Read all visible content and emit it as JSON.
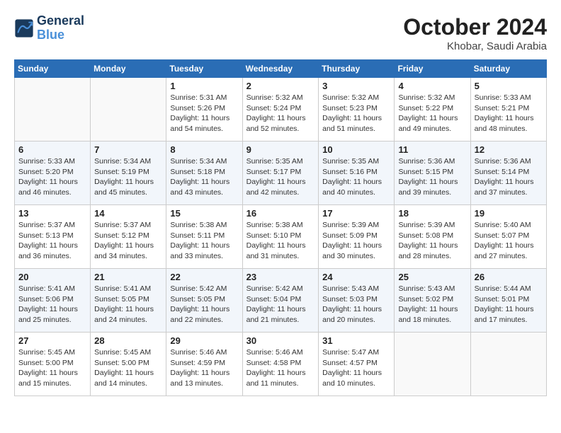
{
  "logo": {
    "line1": "General",
    "line2": "Blue"
  },
  "title": "October 2024",
  "location": "Khobar, Saudi Arabia",
  "weekdays": [
    "Sunday",
    "Monday",
    "Tuesday",
    "Wednesday",
    "Thursday",
    "Friday",
    "Saturday"
  ],
  "weeks": [
    [
      {
        "day": "",
        "info": ""
      },
      {
        "day": "",
        "info": ""
      },
      {
        "day": "1",
        "info": "Sunrise: 5:31 AM\nSunset: 5:26 PM\nDaylight: 11 hours and 54 minutes."
      },
      {
        "day": "2",
        "info": "Sunrise: 5:32 AM\nSunset: 5:24 PM\nDaylight: 11 hours and 52 minutes."
      },
      {
        "day": "3",
        "info": "Sunrise: 5:32 AM\nSunset: 5:23 PM\nDaylight: 11 hours and 51 minutes."
      },
      {
        "day": "4",
        "info": "Sunrise: 5:32 AM\nSunset: 5:22 PM\nDaylight: 11 hours and 49 minutes."
      },
      {
        "day": "5",
        "info": "Sunrise: 5:33 AM\nSunset: 5:21 PM\nDaylight: 11 hours and 48 minutes."
      }
    ],
    [
      {
        "day": "6",
        "info": "Sunrise: 5:33 AM\nSunset: 5:20 PM\nDaylight: 11 hours and 46 minutes."
      },
      {
        "day": "7",
        "info": "Sunrise: 5:34 AM\nSunset: 5:19 PM\nDaylight: 11 hours and 45 minutes."
      },
      {
        "day": "8",
        "info": "Sunrise: 5:34 AM\nSunset: 5:18 PM\nDaylight: 11 hours and 43 minutes."
      },
      {
        "day": "9",
        "info": "Sunrise: 5:35 AM\nSunset: 5:17 PM\nDaylight: 11 hours and 42 minutes."
      },
      {
        "day": "10",
        "info": "Sunrise: 5:35 AM\nSunset: 5:16 PM\nDaylight: 11 hours and 40 minutes."
      },
      {
        "day": "11",
        "info": "Sunrise: 5:36 AM\nSunset: 5:15 PM\nDaylight: 11 hours and 39 minutes."
      },
      {
        "day": "12",
        "info": "Sunrise: 5:36 AM\nSunset: 5:14 PM\nDaylight: 11 hours and 37 minutes."
      }
    ],
    [
      {
        "day": "13",
        "info": "Sunrise: 5:37 AM\nSunset: 5:13 PM\nDaylight: 11 hours and 36 minutes."
      },
      {
        "day": "14",
        "info": "Sunrise: 5:37 AM\nSunset: 5:12 PM\nDaylight: 11 hours and 34 minutes."
      },
      {
        "day": "15",
        "info": "Sunrise: 5:38 AM\nSunset: 5:11 PM\nDaylight: 11 hours and 33 minutes."
      },
      {
        "day": "16",
        "info": "Sunrise: 5:38 AM\nSunset: 5:10 PM\nDaylight: 11 hours and 31 minutes."
      },
      {
        "day": "17",
        "info": "Sunrise: 5:39 AM\nSunset: 5:09 PM\nDaylight: 11 hours and 30 minutes."
      },
      {
        "day": "18",
        "info": "Sunrise: 5:39 AM\nSunset: 5:08 PM\nDaylight: 11 hours and 28 minutes."
      },
      {
        "day": "19",
        "info": "Sunrise: 5:40 AM\nSunset: 5:07 PM\nDaylight: 11 hours and 27 minutes."
      }
    ],
    [
      {
        "day": "20",
        "info": "Sunrise: 5:41 AM\nSunset: 5:06 PM\nDaylight: 11 hours and 25 minutes."
      },
      {
        "day": "21",
        "info": "Sunrise: 5:41 AM\nSunset: 5:05 PM\nDaylight: 11 hours and 24 minutes."
      },
      {
        "day": "22",
        "info": "Sunrise: 5:42 AM\nSunset: 5:05 PM\nDaylight: 11 hours and 22 minutes."
      },
      {
        "day": "23",
        "info": "Sunrise: 5:42 AM\nSunset: 5:04 PM\nDaylight: 11 hours and 21 minutes."
      },
      {
        "day": "24",
        "info": "Sunrise: 5:43 AM\nSunset: 5:03 PM\nDaylight: 11 hours and 20 minutes."
      },
      {
        "day": "25",
        "info": "Sunrise: 5:43 AM\nSunset: 5:02 PM\nDaylight: 11 hours and 18 minutes."
      },
      {
        "day": "26",
        "info": "Sunrise: 5:44 AM\nSunset: 5:01 PM\nDaylight: 11 hours and 17 minutes."
      }
    ],
    [
      {
        "day": "27",
        "info": "Sunrise: 5:45 AM\nSunset: 5:00 PM\nDaylight: 11 hours and 15 minutes."
      },
      {
        "day": "28",
        "info": "Sunrise: 5:45 AM\nSunset: 5:00 PM\nDaylight: 11 hours and 14 minutes."
      },
      {
        "day": "29",
        "info": "Sunrise: 5:46 AM\nSunset: 4:59 PM\nDaylight: 11 hours and 13 minutes."
      },
      {
        "day": "30",
        "info": "Sunrise: 5:46 AM\nSunset: 4:58 PM\nDaylight: 11 hours and 11 minutes."
      },
      {
        "day": "31",
        "info": "Sunrise: 5:47 AM\nSunset: 4:57 PM\nDaylight: 11 hours and 10 minutes."
      },
      {
        "day": "",
        "info": ""
      },
      {
        "day": "",
        "info": ""
      }
    ]
  ]
}
